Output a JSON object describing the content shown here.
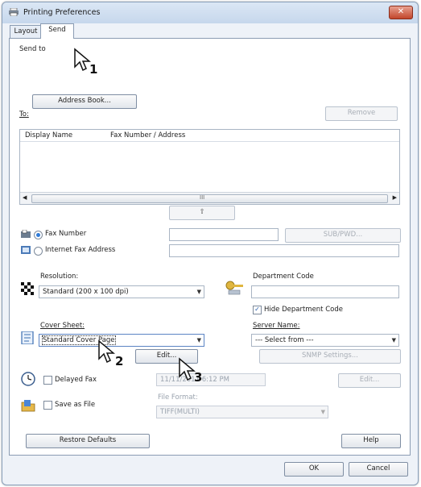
{
  "window": {
    "title": "Printing Preferences",
    "close_label": "✕"
  },
  "tabs": [
    "Layout",
    "Send"
  ],
  "send_to": {
    "group_label": "Send to",
    "address_book": "Address Book...",
    "to_label": "To:",
    "remove": "Remove",
    "columns": [
      "Display Name",
      "Fax Number / Address"
    ],
    "scroll_mid": "III",
    "up_arrow": "⇧",
    "fax_number": "Fax Number",
    "internet_fax": "Internet Fax Address",
    "sub_pwd": "SUB/PWD..."
  },
  "resolution": {
    "label": "Resolution:",
    "value": "Standard (200 x 100 dpi)"
  },
  "department": {
    "label": "Department Code",
    "hide_label": "Hide Department Code",
    "hide_checked": true
  },
  "cover": {
    "label": "Cover Sheet:",
    "value": "Standard Cover Page",
    "edit": "Edit..."
  },
  "server": {
    "label": "Server Name:",
    "value": "--- Select from ---",
    "snmp": "SNMP Settings..."
  },
  "delayed": {
    "label": "Delayed Fax",
    "value": "11/11/2011 6:12 PM",
    "edit": "Edit..."
  },
  "save_file": {
    "label": "Save as File",
    "format_label": "File Format:",
    "format_value": "TIFF(MULTI)"
  },
  "footer": {
    "restore": "Restore Defaults",
    "help": "Help",
    "ok": "OK",
    "cancel": "Cancel"
  },
  "steps": [
    "1",
    "2",
    "3"
  ]
}
